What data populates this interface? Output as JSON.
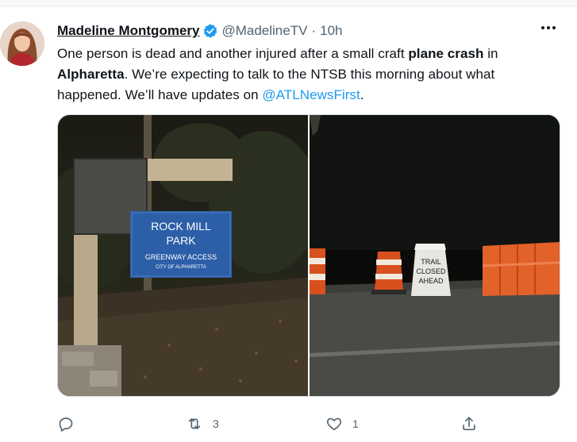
{
  "author": {
    "name": "Madeline Montgomery",
    "handle": "@MadelineTV",
    "separator": "·",
    "time": "10h",
    "verified": true,
    "avatar_icon": "profile-photo"
  },
  "tweet": {
    "text_part1": "One person is dead and another injured after a small craft ",
    "bold1": "plane crash",
    "text_part2": " in ",
    "bold2": "Alpharetta",
    "text_part3": ". We’re expecting to talk to the NTSB this morning about what happened. We’ll have updates on ",
    "mention": "@ATLNewsFirst",
    "text_part4": "."
  },
  "media": {
    "left_photo": {
      "sign_line1": "ROCK MILL",
      "sign_line2": "PARK",
      "sign_line3": "GREENWAY ACCESS",
      "sign_line4": "CITY OF ALPHARETTA"
    },
    "right_photo": {
      "sign_line1": "TRAIL",
      "sign_line2": "CLOSED",
      "sign_line3": "AHEAD"
    }
  },
  "actions": {
    "reply": {
      "icon": "reply-icon",
      "count": ""
    },
    "retweet": {
      "icon": "retweet-icon",
      "count": "3"
    },
    "like": {
      "icon": "heart-icon",
      "count": "1"
    },
    "share": {
      "icon": "share-icon",
      "count": ""
    }
  },
  "colors": {
    "link": "#1d9bf0",
    "verified": "#1d9bf0",
    "muted": "#536471",
    "text": "#0f1419"
  }
}
